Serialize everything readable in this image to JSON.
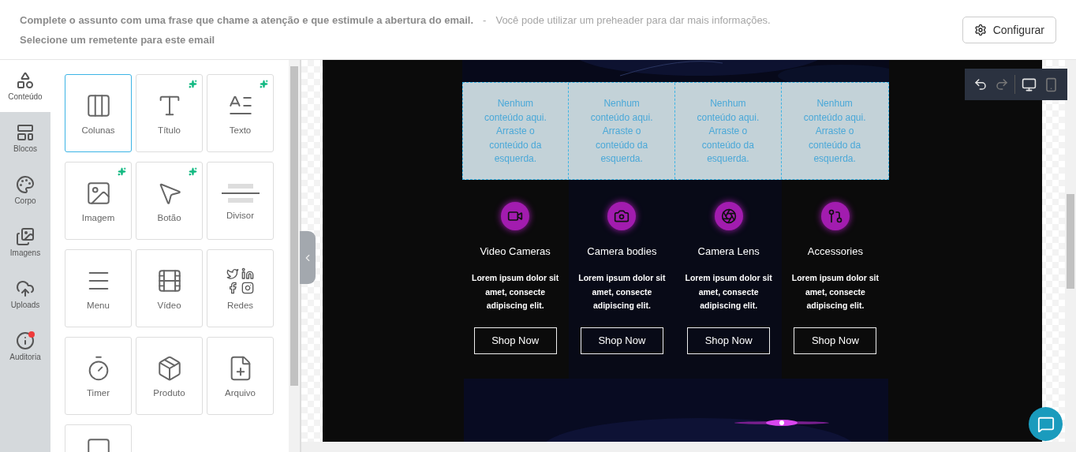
{
  "header": {
    "subject": "Complete o assunto com uma frase que chame a atenção e que estimule a abertura do email.",
    "separator": "-",
    "preheader": "Você pode utilizar um preheader para dar mais informações.",
    "sender": "Selecione um remetente para este email",
    "configure_button": "Configurar"
  },
  "sidebar": {
    "items": [
      {
        "label": "Conteúdo",
        "selected": true,
        "alert": false
      },
      {
        "label": "Blocos",
        "selected": false,
        "alert": false
      },
      {
        "label": "Corpo",
        "selected": false,
        "alert": false
      },
      {
        "label": "Imagens",
        "selected": false,
        "alert": false
      },
      {
        "label": "Uploads",
        "selected": false,
        "alert": false
      },
      {
        "label": "Auditoria",
        "selected": false,
        "alert": true
      }
    ]
  },
  "tiles": [
    {
      "label": "Colunas",
      "selected": true,
      "ai": false
    },
    {
      "label": "Título",
      "selected": false,
      "ai": true
    },
    {
      "label": "Texto",
      "selected": false,
      "ai": true
    },
    {
      "label": "Imagem",
      "selected": false,
      "ai": true
    },
    {
      "label": "Botão",
      "selected": false,
      "ai": true
    },
    {
      "label": "Divisor",
      "selected": false,
      "ai": false
    },
    {
      "label": "Menu",
      "selected": false,
      "ai": false
    },
    {
      "label": "Vídeo",
      "selected": false,
      "ai": false
    },
    {
      "label": "Redes",
      "selected": false,
      "ai": false
    },
    {
      "label": "Timer",
      "selected": false,
      "ai": false
    },
    {
      "label": "Produto",
      "selected": false,
      "ai": false
    },
    {
      "label": "Arquivo",
      "selected": false,
      "ai": false
    },
    {
      "selected": false,
      "ai": false
    }
  ],
  "email": {
    "dropzones": [
      "Nenhum conteúdo aqui. Arraste o conteúdo da esquerda.",
      "Nenhum conteúdo aqui. Arraste o conteúdo da esquerda.",
      "Nenhum conteúdo aqui. Arraste o conteúdo da esquerda.",
      "Nenhum conteúdo aqui. Arraste o conteúdo da esquerda."
    ],
    "products": [
      {
        "title": "Video Cameras",
        "text": "Lorem ipsum dolor sit amet, consecte adipiscing elit.",
        "button": "Shop Now"
      },
      {
        "title": "Camera bodies",
        "text": "Lorem ipsum dolor sit amet, consecte adipiscing elit.",
        "button": "Shop Now"
      },
      {
        "title": "Camera Lens",
        "text": "Lorem ipsum dolor sit amet, consecte adipiscing elit.",
        "button": "Shop Now"
      },
      {
        "title": "Accessories",
        "text": "Lorem ipsum dolor sit amet, consecte adipiscing elit.",
        "button": "Shop Now"
      }
    ]
  },
  "toolbar": {
    "undo_disabled": false,
    "redo_disabled": true,
    "views": [
      {
        "selected": true
      },
      {
        "selected": false
      }
    ]
  }
}
